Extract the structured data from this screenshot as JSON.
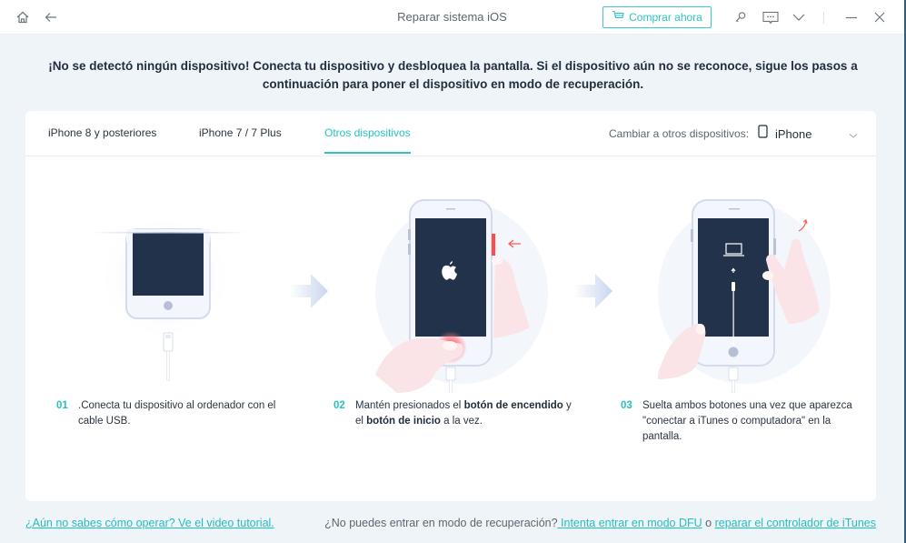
{
  "window": {
    "title": "Reparar sistema iOS",
    "icons": {
      "home": "home-icon",
      "back": "back-arrow-icon",
      "cart": "cart-icon",
      "key": "key-icon",
      "feedback": "feedback-icon",
      "menu": "chevron-down-icon",
      "minimize": "minimize-icon",
      "close": "close-icon"
    },
    "buy_button_label": "Comprar ahora"
  },
  "headline": "¡No se detectó ningún dispositivo! Conecta tu dispositivo y desbloquea la pantalla. Si el dispositivo aún no se reconoce, sigue los pasos a continuación para poner el dispositivo en modo de recuperación.",
  "tabs": [
    {
      "label": "iPhone 8 y posteriores",
      "active": false
    },
    {
      "label": "iPhone 7 / 7 Plus",
      "active": false
    },
    {
      "label": "Otros dispositivos",
      "active": true
    }
  ],
  "device_switch": {
    "label": "Cambiar a otros dispositivos:",
    "selected": "iPhone"
  },
  "steps": [
    {
      "num": "01",
      "text": ".Conecta tu dispositivo al ordenador con el cable USB."
    },
    {
      "num": "02",
      "parts": [
        "Mantén presionados el ",
        "botón de encendido",
        " y el ",
        "botón de inicio",
        " a la vez."
      ]
    },
    {
      "num": "03",
      "text": "Suelta ambos botones una vez que aparezca \"conectar a iTunes o computadora\" en la pantalla."
    }
  ],
  "footer": {
    "tutorial_link": "¿Aún no sabes cómo operar? Ve el video tutorial.",
    "question": "¿No puedes entrar en modo de recuperación?",
    "dfu_link": " Intenta entrar en modo DFU",
    "or": " o ",
    "itunes_link": "reparar el controlador de iTunes"
  },
  "colors": {
    "accent": "#2fc3c1",
    "screen": "#22324a",
    "highlight": "#ff4b4b"
  }
}
